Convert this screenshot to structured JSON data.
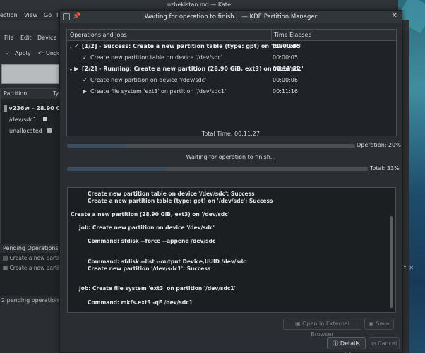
{
  "kate": {
    "title": "uzbekistan.md — Kate",
    "menu": [
      "ection",
      "View",
      "Go",
      "I"
    ]
  },
  "pm": {
    "menu": [
      "File",
      "Edit",
      "Device"
    ],
    "toolbar": {
      "apply": "Apply",
      "undo": "Undo"
    },
    "partition_header": "Partition",
    "partition_header_cut": "Ty",
    "device": "v236w – 28.90 GiB",
    "partitions": [
      "/dev/sdc1",
      "unallocated"
    ],
    "pending_header": "Pending Operations",
    "pending_items": [
      "Create a new partition",
      "Create a new partition"
    ],
    "status": "2 pending operations"
  },
  "dialog": {
    "title": "Waiting for operation to finish... — KDE Partition Manager",
    "columns": {
      "jobs": "Operations and Jobs",
      "time": "Time Elapsed"
    },
    "jobs": [
      {
        "text": "[1/2] - Success: Create a new partition table (type: gpt) on '/dev/sdc'",
        "time": "00:00:05",
        "bold": true,
        "level": 0,
        "icon": "✓"
      },
      {
        "text": "Create new partition table on device '/dev/sdc'",
        "time": "00:00:05",
        "bold": false,
        "level": 1,
        "icon": "✓"
      },
      {
        "text": "[2/2] - Running: Create a new partition (28.90 GiB, ext3) on '/dev/sdc'",
        "time": "00:11:22",
        "bold": true,
        "level": 0,
        "icon": "▶"
      },
      {
        "text": "Create new partition on device '/dev/sdc'",
        "time": "00:00:06",
        "bold": false,
        "level": 1,
        "icon": "✓"
      },
      {
        "text": "Create file system 'ext3' on partition '/dev/sdc1'",
        "time": "00:11:16",
        "bold": false,
        "level": 1,
        "icon": "▶"
      }
    ],
    "total_time": "Total Time: 00:11:27",
    "operation": {
      "label": "Operation: 20%",
      "percent": 20
    },
    "waiting": "Waiting for operation to finish...",
    "total": {
      "label": "Total: 33%",
      "percent": 33
    },
    "log": [
      {
        "text": "Create new partition table on device '/dev/sdc': Success",
        "indent": 2
      },
      {
        "text": "Create a new partition table (type: gpt) on '/dev/sdc': Success",
        "indent": 2
      },
      {
        "text": "",
        "indent": 0
      },
      {
        "text": "Create a new partition (28.90 GiB, ext3) on '/dev/sdc'",
        "indent": 0
      },
      {
        "text": "",
        "indent": 0
      },
      {
        "text": "Job: Create new partition on device '/dev/sdc'",
        "indent": 1
      },
      {
        "text": "",
        "indent": 0
      },
      {
        "text": "Command: sfdisk --force --append /dev/sdc",
        "indent": 2
      },
      {
        "text": "",
        "indent": 0
      },
      {
        "text": "",
        "indent": 0
      },
      {
        "text": "Command: sfdisk --list --output Device,UUID /dev/sdc",
        "indent": 2
      },
      {
        "text": "Create new partition '/dev/sdc1': Success",
        "indent": 2
      },
      {
        "text": "",
        "indent": 0
      },
      {
        "text": "",
        "indent": 0
      },
      {
        "text": "Job: Create file system 'ext3' on partition '/dev/sdc1'",
        "indent": 1
      },
      {
        "text": "",
        "indent": 0
      },
      {
        "text": "Command: mkfs.ext3 -qF /dev/sdc1",
        "indent": 2
      }
    ],
    "buttons": {
      "open_browser": "Open in External Browser",
      "save": "Save",
      "details": "Details <<",
      "cancel": "Cancel"
    }
  }
}
